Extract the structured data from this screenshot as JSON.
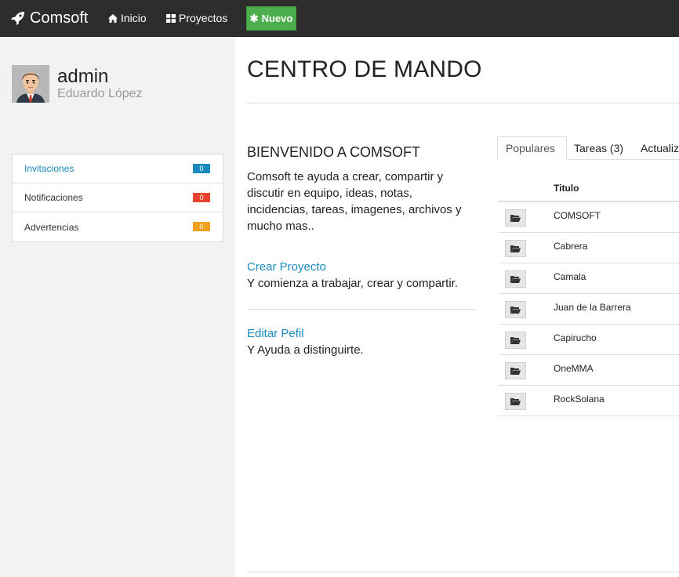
{
  "navbar": {
    "brand": "Comsoft",
    "inicio": "Inicio",
    "proyectos": "Proyectos",
    "nuevo": "Nuevo",
    "colors": {
      "background": "#2d2d2d",
      "nuevo": "#4cae4c"
    }
  },
  "sidebar": {
    "username": "admin",
    "fullname": "Eduardo López",
    "items": [
      {
        "label": "Invitaciones",
        "count": "0",
        "color": "#1a8bbf"
      },
      {
        "label": "Notificaciones",
        "count": "0",
        "color": "#e8432e"
      },
      {
        "label": "Advertencias",
        "count": "0",
        "color": "#f0a01c"
      }
    ]
  },
  "main": {
    "title": "CENTRO DE MANDO",
    "welcome_title": "BIENVENIDO A COMSOFT",
    "welcome_text": "Comsoft te ayuda a crear, compartir y discutir en equipo, ideas, notas, incidencias, tareas, imagenes, archivos y mucho mas..",
    "create_link": "Crear Proyecto",
    "create_desc": "Y comienza a trabajar, crear y compartir.",
    "edit_link": "Editar Pefil",
    "edit_desc": "Y Ayuda a distinguirte."
  },
  "tabs": [
    "Populares",
    "Tareas (3)",
    "Actualiz"
  ],
  "table": {
    "header": "Titulo",
    "rows": [
      "COMSOFT",
      "Cabrera",
      "Camala",
      "Juan de la Barrera",
      "Capirucho",
      "OneMMA",
      "RockSolana"
    ]
  }
}
